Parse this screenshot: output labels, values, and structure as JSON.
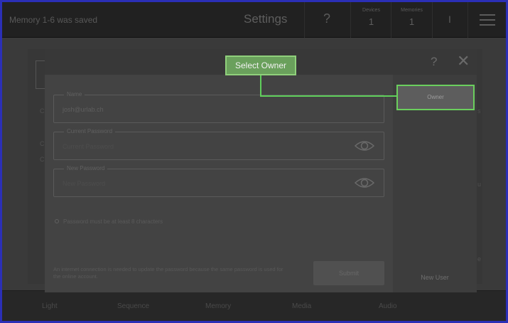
{
  "topbar": {
    "status": "Memory 1-6 was saved",
    "title": "Settings",
    "help": "?",
    "devices": {
      "label": "Devices",
      "value": "1"
    },
    "memories": {
      "label": "Memories",
      "value": "1"
    },
    "user_icon": "user-icon",
    "menu_icon": "hamburger-menu-icon"
  },
  "bottombar": {
    "items": [
      "Light",
      "Sequence",
      "Memory",
      "Media",
      "Audio"
    ]
  },
  "modal": {
    "help": "?",
    "close": "✕",
    "fields": {
      "name": {
        "label": "Name",
        "value": "josh@urlab.ch"
      },
      "current_password": {
        "label": "Current Password",
        "placeholder": "Current Password"
      },
      "new_password": {
        "label": "New Password",
        "placeholder": "New Password"
      }
    },
    "hint": "Password must be at least 8 characters",
    "note": "An internet connection is needed to update the password because the same password is used for the online account.",
    "submit_label": "Submit",
    "new_user_label": "New User"
  },
  "highlight": {
    "select_owner": "Select Owner",
    "owner_button": "Owner",
    "accent": "#6bcf5d"
  }
}
